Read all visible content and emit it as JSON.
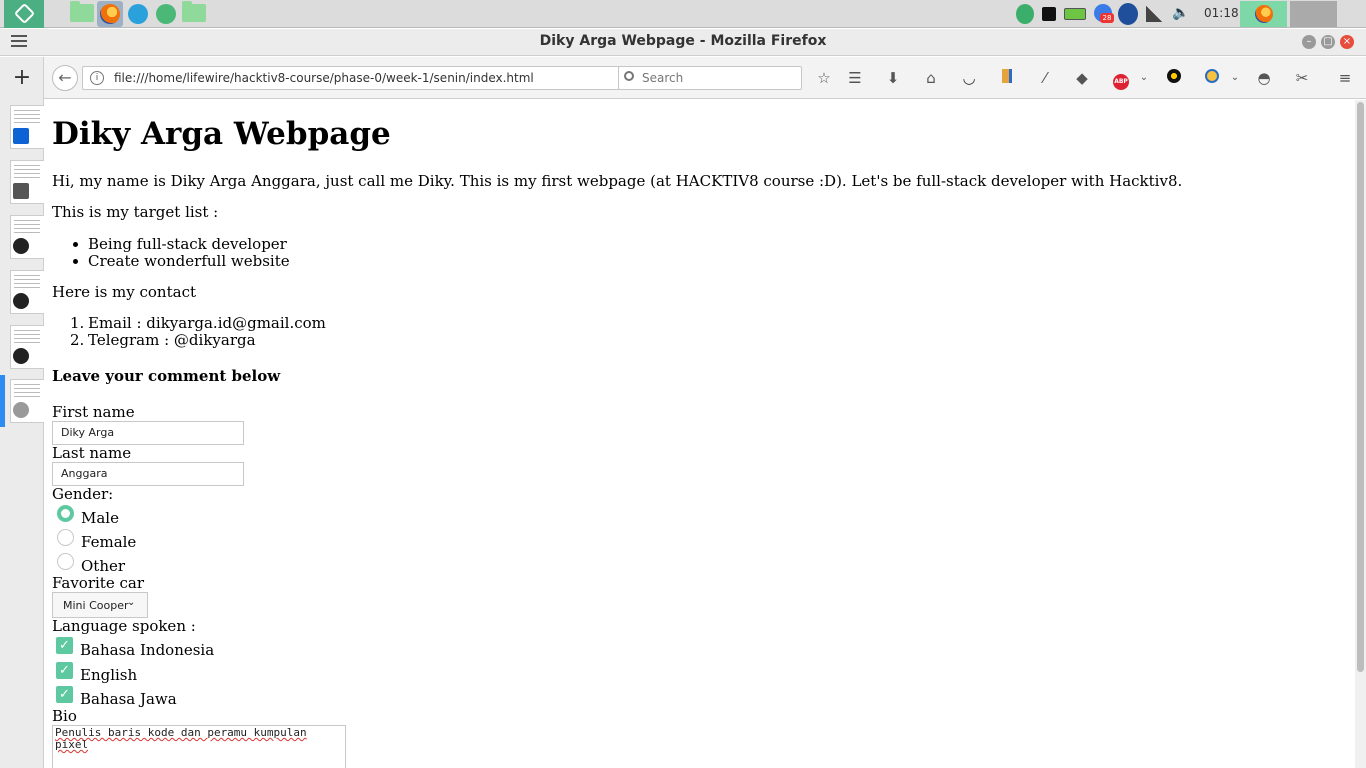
{
  "panel": {
    "clock": "01:18",
    "notification_count": "28"
  },
  "window": {
    "title": "Diky Arga Webpage - Mozilla Firefox"
  },
  "toolbar": {
    "url": "file:///home/lifewire/hacktiv8-course/phase-0/week-1/senin/index.html",
    "search_placeholder": "Search"
  },
  "page": {
    "heading": "Diky Arga Webpage",
    "intro": "Hi, my name is Diky Arga Anggara, just call me Diky. This is my first webpage (at HACKTIV8 course :D). Let's be full-stack developer with Hacktiv8.",
    "target_label": "This is my target list :",
    "targets": [
      "Being full-stack developer",
      "Create wonderfull website"
    ],
    "contact_label": "Here is my contact",
    "contacts": [
      "Email : dikyarga.id@gmail.com",
      "Telegram : @dikyarga"
    ],
    "comment_heading": "Leave your comment below",
    "form": {
      "first_name_label": "First name",
      "first_name_value": "Diky Arga",
      "last_name_label": "Last name",
      "last_name_value": "Anggara",
      "gender_label": "Gender:",
      "gender_options": [
        "Male",
        "Female",
        "Other"
      ],
      "gender_selected": "Male",
      "car_label": "Favorite car",
      "car_value": "Mini Cooper",
      "language_label": "Language spoken :",
      "languages": [
        "Bahasa Indonesia",
        "English",
        "Bahasa Jawa"
      ],
      "bio_label": "Bio",
      "bio_value": "Penulis baris kode dan peramu kumpulan pixel"
    }
  }
}
